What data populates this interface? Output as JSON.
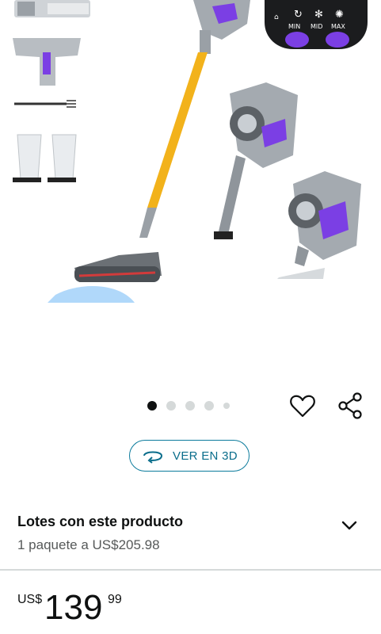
{
  "gallery": {
    "display_panel_labels": [
      "MIN",
      "MID",
      "MAX"
    ],
    "image_count": 5,
    "active_image": 1
  },
  "actions": {
    "view_3d_label": "VER EN 3D"
  },
  "lotes": {
    "title": "Lotes con este producto",
    "subtitle": "1 paquete a US$205.98"
  },
  "price": {
    "currency": "US$",
    "whole": "139",
    "fraction": "99"
  },
  "colors": {
    "accent_purple": "#7b3fe4",
    "pole_yellow": "#f2b21b",
    "link_teal": "#0a6d8b",
    "body_gray": "#9aa0a6"
  },
  "icons": [
    "heart-icon",
    "share-icon",
    "rotate-3d-icon",
    "chevron-down-icon"
  ]
}
